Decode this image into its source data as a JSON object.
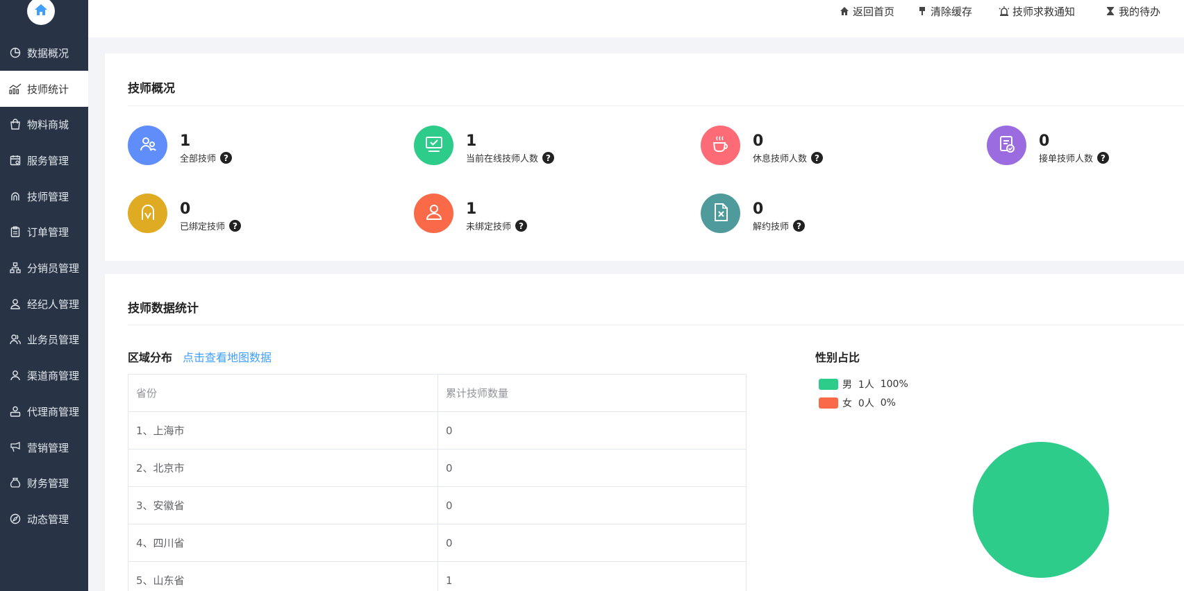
{
  "sidebar": {
    "items": [
      {
        "label": "数据概况",
        "icon": "pie-chart-icon"
      },
      {
        "label": "技师统计",
        "icon": "trend-chart-icon"
      },
      {
        "label": "物料商城",
        "icon": "shopping-bag-icon"
      },
      {
        "label": "服务管理",
        "icon": "service-calendar-icon"
      },
      {
        "label": "技师管理",
        "icon": "technician-icon"
      },
      {
        "label": "订单管理",
        "icon": "clipboard-icon"
      },
      {
        "label": "分销员管理",
        "icon": "org-chart-icon"
      },
      {
        "label": "经纪人管理",
        "icon": "agent-person-icon"
      },
      {
        "label": "业务员管理",
        "icon": "users-icon"
      },
      {
        "label": "渠道商管理",
        "icon": "user-icon"
      },
      {
        "label": "代理商管理",
        "icon": "user-card-icon"
      },
      {
        "label": "营销管理",
        "icon": "megaphone-icon"
      },
      {
        "label": "财务管理",
        "icon": "money-bag-icon"
      },
      {
        "label": "动态管理",
        "icon": "compass-icon"
      }
    ],
    "active_index": 1
  },
  "topbar": {
    "links": [
      {
        "label": "返回首页",
        "icon": "home-icon"
      },
      {
        "label": "清除缓存",
        "icon": "brush-icon"
      },
      {
        "label": "技师求救通知",
        "icon": "alarm-icon"
      },
      {
        "label": "我的待办",
        "icon": "hourglass-icon"
      }
    ]
  },
  "overview": {
    "title": "技师概况",
    "stats": [
      {
        "value": "1",
        "label": "全部技师",
        "color": "#5f8dfa",
        "icon": "users-icon"
      },
      {
        "value": "1",
        "label": "当前在线技师人数",
        "color": "#2ecc8b",
        "icon": "monitor-check-icon"
      },
      {
        "value": "0",
        "label": "休息技师人数",
        "color": "#fc6b76",
        "icon": "coffee-cup-icon"
      },
      {
        "value": "0",
        "label": "接单技师人数",
        "color": "#9b6ce0",
        "icon": "order-check-icon"
      },
      {
        "value": "0",
        "label": "已绑定技师",
        "color": "#dfab22",
        "icon": "bound-person-icon"
      },
      {
        "value": "1",
        "label": "未绑定技师",
        "color": "#fa6a48",
        "icon": "person-icon"
      },
      {
        "value": "0",
        "label": "解约技师",
        "color": "#4f9a9b",
        "icon": "file-x-icon"
      }
    ]
  },
  "statistics": {
    "title": "技师数据统计",
    "region": {
      "title": "区域分布",
      "map_link": "点击查看地图数据",
      "columns": [
        "省份",
        "累计技师数量"
      ],
      "rows": [
        [
          "1、上海市",
          "0"
        ],
        [
          "2、北京市",
          "0"
        ],
        [
          "3、安徽省",
          "0"
        ],
        [
          "4、四川省",
          "0"
        ],
        [
          "5、山东省",
          "1"
        ]
      ]
    },
    "gender": {
      "title": "性别占比",
      "legend": [
        {
          "name": "男",
          "count": "1人",
          "percent": "100%",
          "color": "#2ecc8b"
        },
        {
          "name": "女",
          "count": "0人",
          "percent": "0%",
          "color": "#fa6a48"
        }
      ]
    }
  },
  "chart_data": {
    "type": "pie",
    "categories": [
      "男",
      "女"
    ],
    "values": [
      1,
      0
    ],
    "colors": [
      "#2ecc8b",
      "#fa6a48"
    ],
    "legend": "top-left"
  }
}
